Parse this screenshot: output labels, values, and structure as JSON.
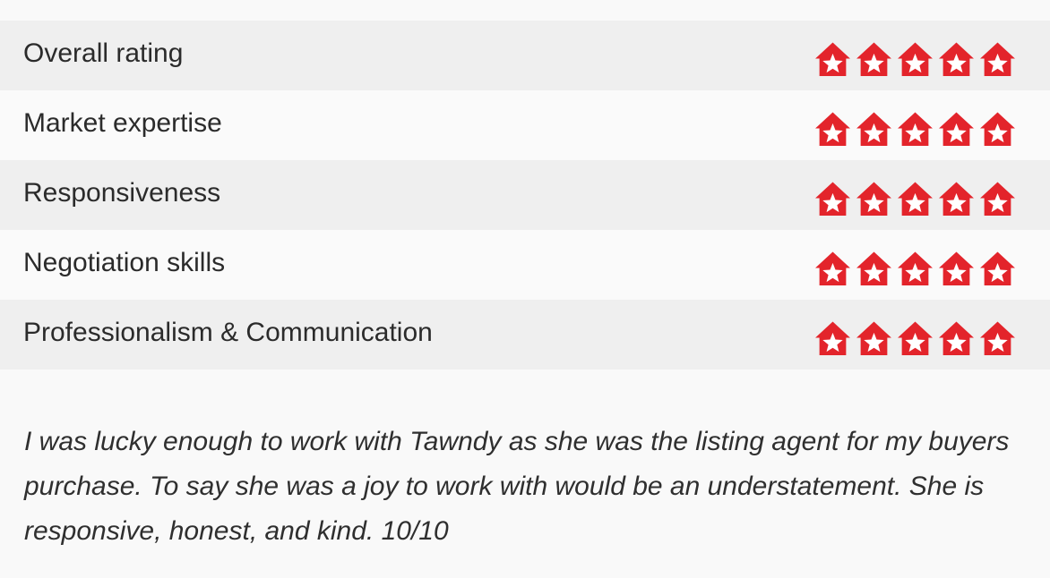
{
  "brand_color": "#e3242b",
  "ratings": [
    {
      "label": "Overall rating",
      "score": 5,
      "max": 5
    },
    {
      "label": "Market expertise",
      "score": 5,
      "max": 5
    },
    {
      "label": "Responsiveness",
      "score": 5,
      "max": 5
    },
    {
      "label": "Negotiation skills",
      "score": 5,
      "max": 5
    },
    {
      "label": "Professionalism & Communication",
      "score": 5,
      "max": 5
    }
  ],
  "star_icon": "house-star-icon",
  "review_text": "I was lucky enough to work with Tawndy as she was the listing agent for my buyers purchase. To say she was a joy to work with would be an understatement. She is responsive, honest, and kind. 10/10"
}
